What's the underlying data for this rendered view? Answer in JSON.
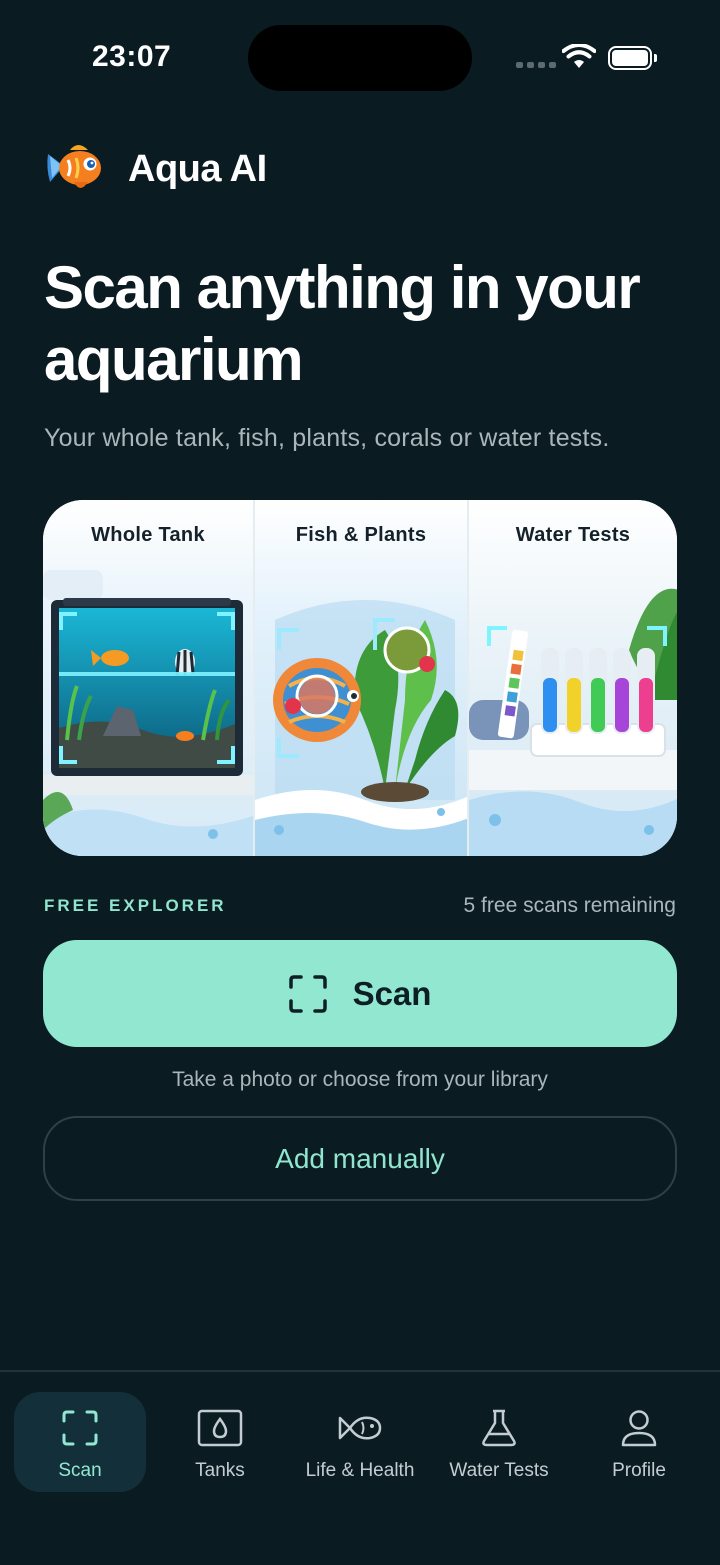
{
  "status_bar": {
    "time": "23:07"
  },
  "brand": {
    "name": "Aqua AI"
  },
  "hero": {
    "headline": "Scan anything in your aquarium",
    "subtitle": "Your whole tank, fish, plants, corals or water tests."
  },
  "categories": [
    {
      "label": "Whole Tank",
      "icon": "aquarium-tank-illustration"
    },
    {
      "label": "Fish & Plants",
      "icon": "fish-and-plant-illustration"
    },
    {
      "label": "Water Tests",
      "icon": "test-tubes-illustration"
    }
  ],
  "plan": {
    "label": "FREE EXPLORER",
    "scans_remaining": "5 free scans remaining"
  },
  "actions": {
    "scan_label": "Scan",
    "scan_hint": "Take a photo or choose from your library",
    "manual_label": "Add manually"
  },
  "tabs": [
    {
      "label": "Scan",
      "icon": "scan-frame-icon",
      "active": true
    },
    {
      "label": "Tanks",
      "icon": "tank-drop-icon",
      "active": false
    },
    {
      "label": "Life & Health",
      "icon": "fish-icon",
      "active": false
    },
    {
      "label": "Water Tests",
      "icon": "flask-icon",
      "active": false
    },
    {
      "label": "Profile",
      "icon": "person-icon",
      "active": false
    }
  ],
  "colors": {
    "background": "#0b1b22",
    "accent": "#92e7d0",
    "muted_text": "#a9b6bb"
  }
}
